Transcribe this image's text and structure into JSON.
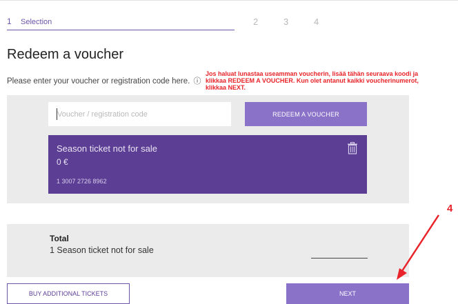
{
  "steps": {
    "current_number": "1",
    "current_label": "Selection",
    "step2": "2",
    "step3": "3",
    "step4": "4"
  },
  "title": "Redeem a voucher",
  "instruction": "Please enter your voucher or registration code here.",
  "info_icon": "ⓘ",
  "annotation_note": "Jos haluat lunastaa useamman voucherin, lisää tähän seuraava koodi ja klikkaa REDEEM A VOUCHER. Kun olet antanut kaikki voucherinumerot, klikkaa NEXT.",
  "voucher_input": {
    "placeholder": "Voucher / registration code",
    "value": ""
  },
  "redeem_button": "REDEEM A VOUCHER",
  "ticket_card": {
    "name": "Season ticket not for sale",
    "price": "0 €",
    "code": "1 3007 2726 8962",
    "delete_icon": "trash-icon"
  },
  "total": {
    "label": "Total",
    "description": "1 Season ticket not for sale"
  },
  "buy_button": "BUY ADDITIONAL TICKETS",
  "next_button": "NEXT",
  "annotation_arrow_number": "4",
  "colors": {
    "accent": "#6a54a8",
    "button": "#8a72c8",
    "card": "#5d3e95",
    "annotation": "#e8242a",
    "panel": "#ebebeb"
  }
}
